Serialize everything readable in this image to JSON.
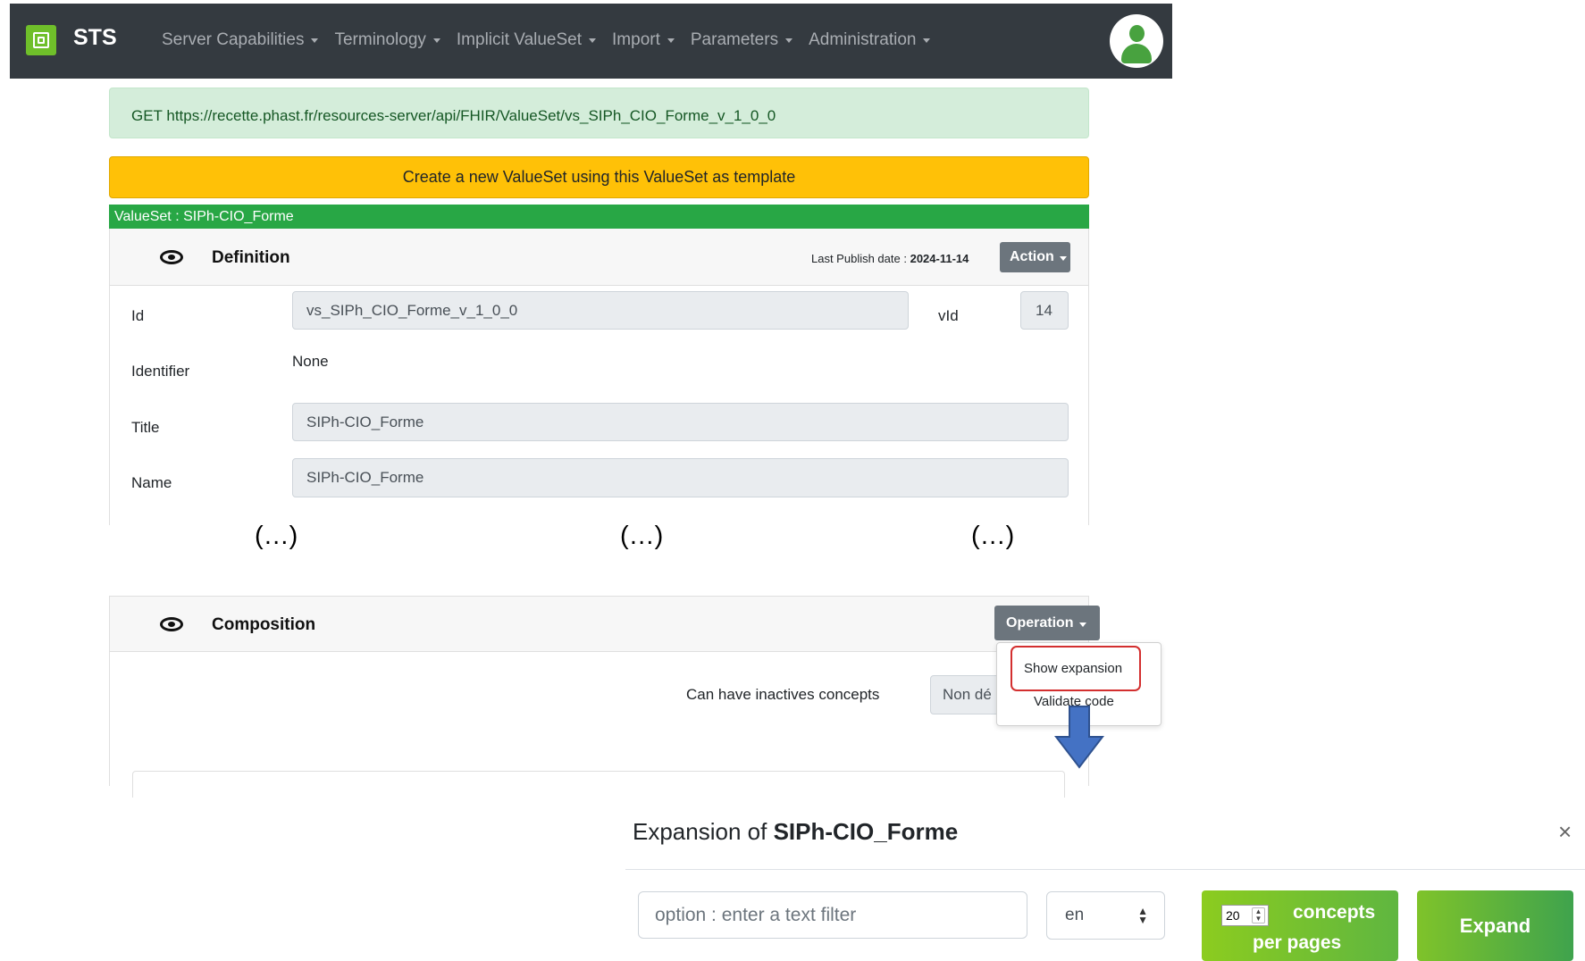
{
  "navbar": {
    "brand": "STS",
    "items": [
      {
        "label": "Server Capabilities"
      },
      {
        "label": "Terminology"
      },
      {
        "label": "Implicit ValueSet"
      },
      {
        "label": "Import"
      },
      {
        "label": "Parameters"
      },
      {
        "label": "Administration"
      }
    ]
  },
  "request": {
    "text": "GET https://recette.phast.fr/resources-server/api/FHIR/ValueSet/vs_SIPh_CIO_Forme_v_1_0_0"
  },
  "create_button": "Create a new ValueSet using this ValueSet as template",
  "valueset_header": "ValueSet : SIPh-CIO_Forme",
  "definition": {
    "title": "Definition",
    "publish_label": "Last Publish date :",
    "publish_date": "2024-11-14",
    "action_label": "Action",
    "fields": {
      "id_label": "Id",
      "id_value": "vs_SIPh_CIO_Forme_v_1_0_0",
      "vid_label": "vId",
      "vid_value": "14",
      "identifier_label": "Identifier",
      "identifier_value": "None",
      "title_label": "Title",
      "title_value": "SIPh-CIO_Forme",
      "name_label": "Name",
      "name_value": "SIPh-CIO_Forme"
    }
  },
  "ellipsis": "(…)",
  "composition": {
    "title": "Composition",
    "operation_label": "Operation",
    "menu": [
      "Show expansion",
      "Validate code"
    ],
    "inactive_label": "Can have inactives concepts",
    "inactive_value": "Non dé"
  },
  "expansion": {
    "title_prefix": "Expansion of ",
    "title_name": "SIPh-CIO_Forme",
    "close": "×",
    "filter_placeholder": "option : enter a text filter",
    "language": "en",
    "page_size": "20",
    "concepts_line1": "concepts",
    "concepts_line2": "per pages",
    "expand_label": "Expand"
  }
}
